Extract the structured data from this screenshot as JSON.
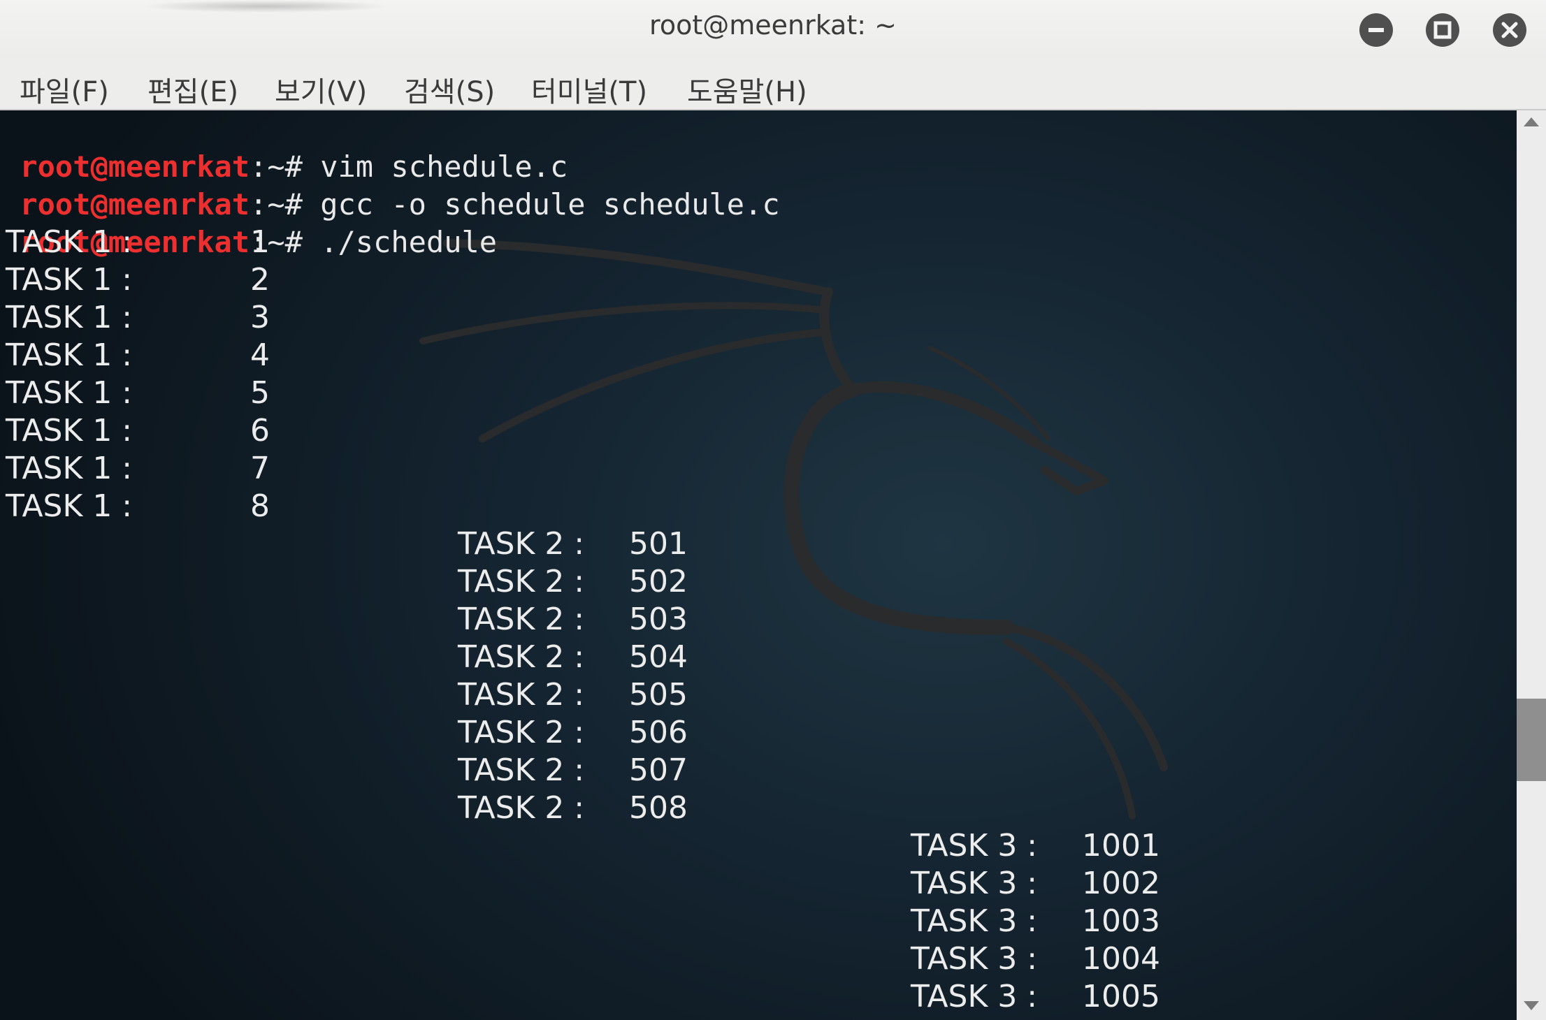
{
  "window": {
    "title": "root@meenrkat: ~",
    "controls": [
      "minimize-icon",
      "maximize-icon",
      "close-icon"
    ]
  },
  "menu": {
    "items": [
      {
        "label": "파일(F)"
      },
      {
        "label": "편집(E)"
      },
      {
        "label": "보기(V)"
      },
      {
        "label": "검색(S)"
      },
      {
        "label": "터미널(T)"
      },
      {
        "label": "도움말(H)"
      }
    ]
  },
  "terminal": {
    "commands": [
      {
        "user": "root@meenrkat",
        "sep": ":~#",
        "cmd": " vim schedule.c"
      },
      {
        "user": "root@meenrkat",
        "sep": ":~#",
        "cmd": " gcc -o schedule schedule.c"
      },
      {
        "user": "root@meenrkat",
        "sep": ":~#",
        "cmd": " ./schedule"
      }
    ],
    "task1": [
      {
        "label": "TASK 1 :",
        "value": "1"
      },
      {
        "label": "TASK 1 :",
        "value": "2"
      },
      {
        "label": "TASK 1 :",
        "value": "3"
      },
      {
        "label": "TASK 1 :",
        "value": "4"
      },
      {
        "label": "TASK 1 :",
        "value": "5"
      },
      {
        "label": "TASK 1 :",
        "value": "6"
      },
      {
        "label": "TASK 1 :",
        "value": "7"
      },
      {
        "label": "TASK 1 :",
        "value": "8"
      }
    ],
    "task2": [
      {
        "label": "TASK 2 :",
        "value": "501"
      },
      {
        "label": "TASK 2 :",
        "value": "502"
      },
      {
        "label": "TASK 2 :",
        "value": "503"
      },
      {
        "label": "TASK 2 :",
        "value": "504"
      },
      {
        "label": "TASK 2 :",
        "value": "505"
      },
      {
        "label": "TASK 2 :",
        "value": "506"
      },
      {
        "label": "TASK 2 :",
        "value": "507"
      },
      {
        "label": "TASK 2 :",
        "value": "508"
      }
    ],
    "task3": [
      {
        "label": "TASK 3 :",
        "value": "1001"
      },
      {
        "label": "TASK 3 :",
        "value": "1002"
      },
      {
        "label": "TASK 3 :",
        "value": "1003"
      },
      {
        "label": "TASK 3 :",
        "value": "1004"
      },
      {
        "label": "TASK 3 :",
        "value": "1005"
      }
    ],
    "background_logo": "kali-dragon-icon"
  },
  "colors": {
    "prompt_user": "#ee2f2f",
    "terminal_text": "#ececec",
    "terminal_bg": "#0d141b"
  }
}
